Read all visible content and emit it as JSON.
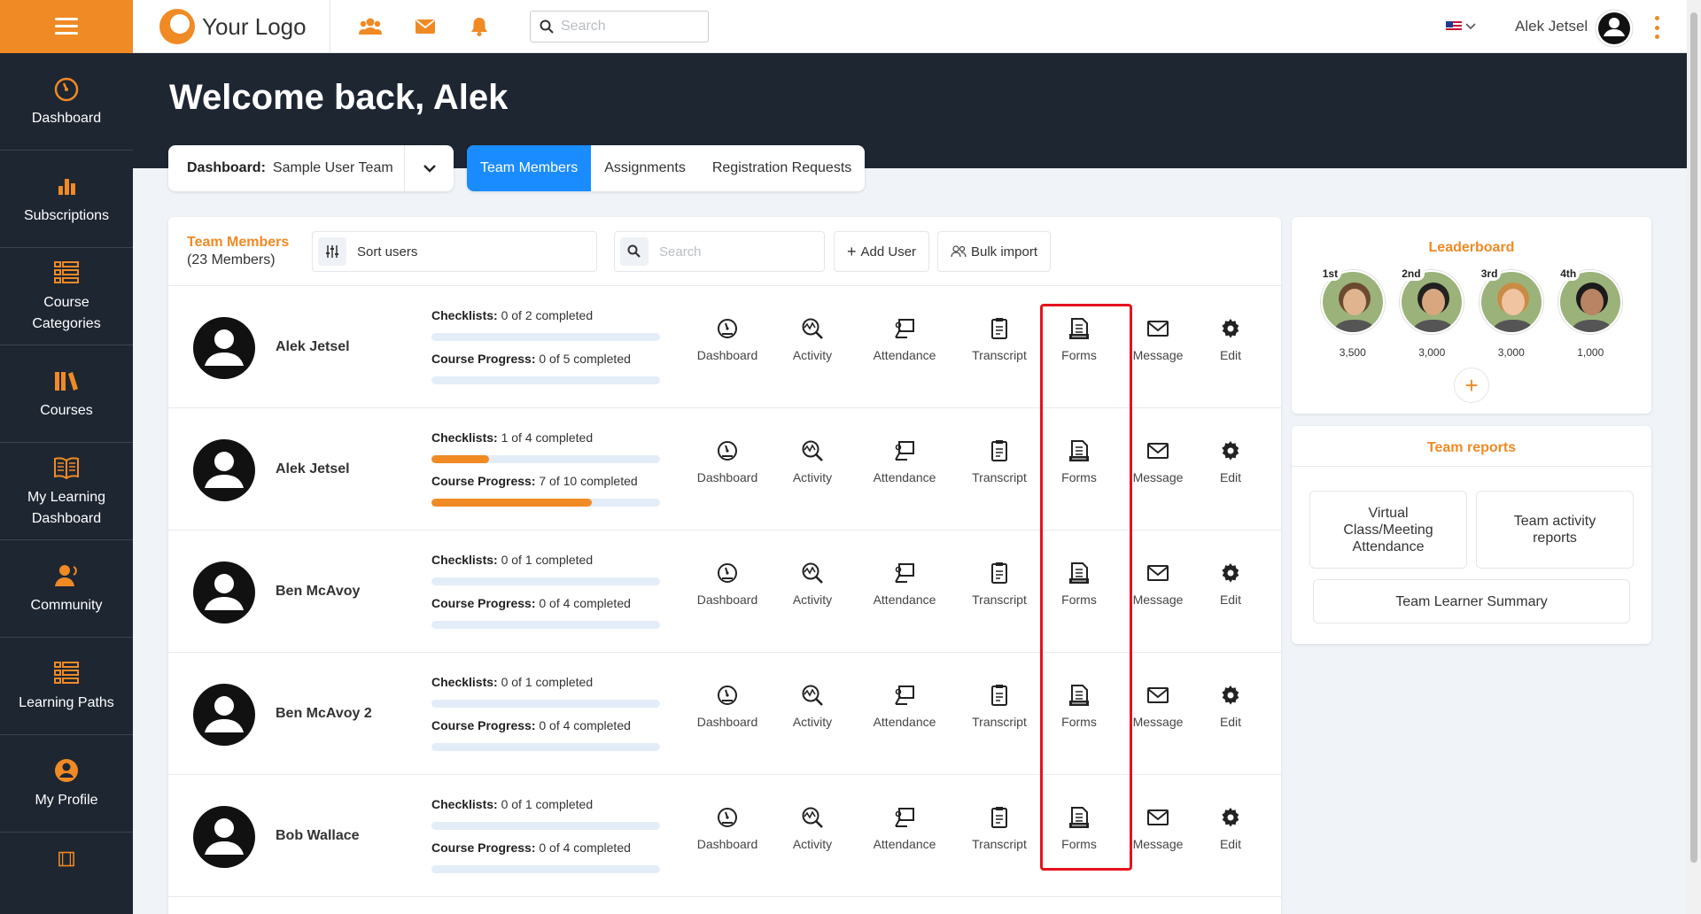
{
  "header": {
    "logo_text": "Your Logo",
    "search_placeholder": "Search",
    "user_name": "Alek Jetsel"
  },
  "sidebar": {
    "items": [
      {
        "label": "Dashboard",
        "icon": "gauge-icon"
      },
      {
        "label": "Subscriptions",
        "icon": "bar-chart-icon"
      },
      {
        "label": "Course Categories",
        "icon": "list-icon"
      },
      {
        "label": "Courses",
        "icon": "books-icon"
      },
      {
        "label": "My Learning Dashboard",
        "icon": "open-book-icon"
      },
      {
        "label": "Community",
        "icon": "community-icon"
      },
      {
        "label": "Learning Paths",
        "icon": "list-icon"
      },
      {
        "label": "My Profile",
        "icon": "user-circle-icon"
      }
    ]
  },
  "welcome": "Welcome back, Alek",
  "dashboard_select": {
    "label": "Dashboard:",
    "value": "Sample User Team"
  },
  "tabs": [
    {
      "label": "Team Members",
      "active": true
    },
    {
      "label": "Assignments",
      "active": false
    },
    {
      "label": "Registration Requests",
      "active": false
    }
  ],
  "team": {
    "title": "Team Members",
    "count": "(23 Members)",
    "sort_label": "Sort users",
    "search_placeholder": "Search",
    "add_user": "Add User",
    "bulk_import": "Bulk import",
    "checklists_label": "Checklists:",
    "progress_label": "Course Progress:",
    "actions": [
      "Dashboard",
      "Activity",
      "Attendance",
      "Transcript",
      "Forms",
      "Message",
      "Edit"
    ],
    "members": [
      {
        "name": "Alek Jetsel",
        "checklists": "0 of 2 completed",
        "checklist_pct": 0,
        "progress": "0 of 5 completed",
        "progress_pct": 0
      },
      {
        "name": "Alek Jetsel",
        "checklists": "1 of 4 completed",
        "checklist_pct": 25,
        "progress": "7 of 10 completed",
        "progress_pct": 70
      },
      {
        "name": "Ben McAvoy",
        "checklists": "0 of 1 completed",
        "checklist_pct": 0,
        "progress": "0 of 4 completed",
        "progress_pct": 0
      },
      {
        "name": "Ben McAvoy 2",
        "checklists": "0 of 1 completed",
        "checklist_pct": 0,
        "progress": "0 of 4 completed",
        "progress_pct": 0
      },
      {
        "name": "Bob Wallace",
        "checklists": "0 of 1 completed",
        "checklist_pct": 0,
        "progress": "0 of 4 completed",
        "progress_pct": 0
      }
    ]
  },
  "leaderboard": {
    "title": "Leaderboard",
    "entries": [
      {
        "rank": "1st",
        "points": "3,500"
      },
      {
        "rank": "2nd",
        "points": "3,000"
      },
      {
        "rank": "3rd",
        "points": "3,000"
      },
      {
        "rank": "4th",
        "points": "1,000"
      }
    ]
  },
  "team_reports": {
    "title": "Team reports",
    "buttons": [
      "Virtual Class/Meeting Attendance",
      "Team activity reports",
      "Team Learner Summary"
    ]
  },
  "colors": {
    "accent": "#f08a24",
    "primary": "#1a8cff",
    "dark": "#1e2632",
    "highlight": "#e5131d"
  }
}
